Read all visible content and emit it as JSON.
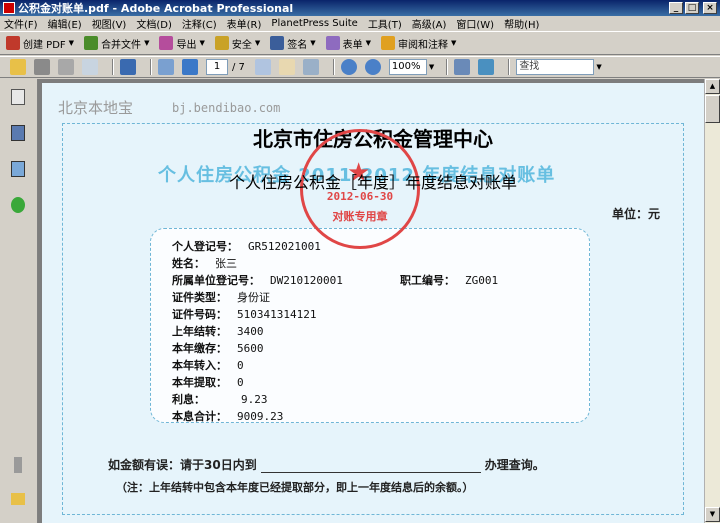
{
  "window": {
    "title": "公积金对账单.pdf - Adobe Acrobat Professional"
  },
  "menu": [
    "文件(F)",
    "编辑(E)",
    "视图(V)",
    "文档(D)",
    "注释(C)",
    "表单(R)",
    "PlanetPress Suite",
    "工具(T)",
    "高级(A)",
    "窗口(W)",
    "帮助(H)"
  ],
  "toolbar": {
    "create_pdf": "创建 PDF",
    "combine": "合并文件",
    "export": "导出",
    "secure": "安全",
    "sign": "签名",
    "forms": "表单",
    "review": "审阅和注释"
  },
  "nav": {
    "page_current": "1",
    "page_total": "/ 7",
    "zoom": "100%",
    "find_placeholder": "查找"
  },
  "document": {
    "watermark_text": "北京本地宝",
    "watermark_url": "bj.bendibao.com",
    "title": "北京市住房公积金管理中心",
    "background_heading": "个人住房公积金 2011-2012 年度结息对账单",
    "subtitle": "个人住房公积金［年度］年度结息对账单",
    "stamp_date": "2012-06-30",
    "stamp_label": "对账专用章",
    "unit_label": "单位：元",
    "fields": {
      "personal_id_label": "个人登记号：",
      "personal_id": "GR512021001",
      "name_label": "姓名：",
      "name": "张三",
      "unit_id_label": "所属单位登记号：",
      "unit_id": "DW210120001",
      "employee_no_label": "职工编号：",
      "employee_no": "ZG001",
      "id_type_label": "证件类型：",
      "id_type": "身份证",
      "id_number_label": "证件号码：",
      "id_number": "510341314121",
      "prev_balance_label": "上年结转：",
      "prev_balance": "3400",
      "deposit_label": "本年缴存：",
      "deposit": "5600",
      "transfer_in_label": "本年转入：",
      "transfer_in": "0",
      "withdraw_label": "本年提取：",
      "withdraw": "0",
      "interest_label": "利息：",
      "interest": "9.23",
      "total_label": "本息合计：",
      "total": "9009.23"
    },
    "footer_line1_a": "如金额有误：请于30日内到",
    "footer_line1_b": "办理查询。",
    "footer_line2": "（注：上年结转中包含本年度已经提取部分，即上一年度结息后的余额。）"
  },
  "colors": {
    "title_bar": "#0a246a",
    "page_bg": "#e6f4fb",
    "frame_border": "#6fb6d6",
    "stamp": "#e04646"
  }
}
